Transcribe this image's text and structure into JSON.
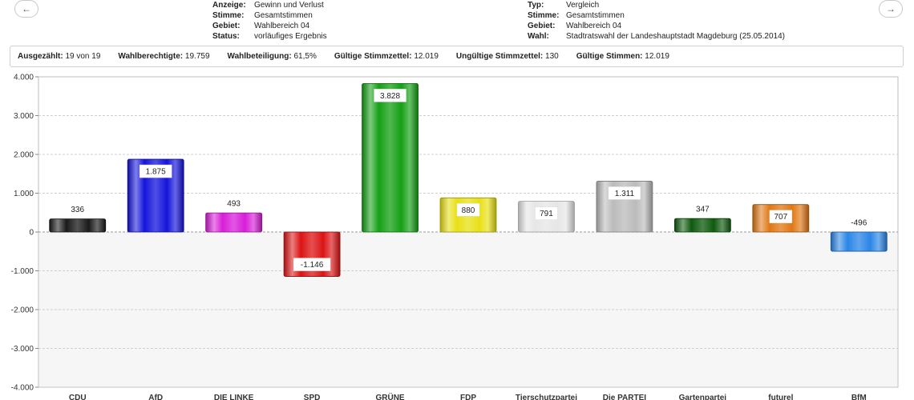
{
  "nav": {
    "prev_icon": "←",
    "next_icon": "→"
  },
  "meta_left": [
    {
      "key": "Anzeige:",
      "value": "Gewinn und Verlust"
    },
    {
      "key": "Stimme:",
      "value": "Gesamtstimmen"
    },
    {
      "key": "Gebiet:",
      "value": "Wahlbereich 04"
    },
    {
      "key": "Status:",
      "value": "vorläufiges Ergebnis"
    }
  ],
  "meta_right": [
    {
      "key": "Typ:",
      "value": "Vergleich"
    },
    {
      "key": "Stimme:",
      "value": "Gesamtstimmen"
    },
    {
      "key": "Gebiet:",
      "value": "Wahlbereich 04"
    },
    {
      "key": "Wahl:",
      "value": "Stadtratswahl der Landeshauptstadt Magdeburg (25.05.2014)"
    }
  ],
  "stats": [
    {
      "label": "Ausgezählt:",
      "value": "19 von 19"
    },
    {
      "label": "Wahlberechtigte:",
      "value": "19.759"
    },
    {
      "label": "Wahlbeteiligung:",
      "value": "61,5%"
    },
    {
      "label": "Gültige Stimmzettel:",
      "value": "12.019"
    },
    {
      "label": "Ungültige Stimmzettel:",
      "value": "130"
    },
    {
      "label": "Gültige Stimmen:",
      "value": "12.019"
    }
  ],
  "chart_data": {
    "type": "bar",
    "categories": [
      "CDU",
      "AfD",
      "DIE LINKE",
      "SPD",
      "GRÜNE",
      "FDP",
      "Tierschutzpartei",
      "Die PARTEI",
      "Gartenpartei",
      "futurel",
      "BfM"
    ],
    "values": [
      336,
      1875,
      493,
      -1146,
      3828,
      880,
      791,
      1311,
      347,
      707,
      -496
    ],
    "value_labels": [
      "336",
      "1.875",
      "493",
      "-1.146",
      "3.828",
      "880",
      "791",
      "1.311",
      "347",
      "707",
      "-496"
    ],
    "colors": [
      "#1a1a1a",
      "#1414dc",
      "#d81ed8",
      "#dc1414",
      "#14a014",
      "#e8e014",
      "#e6e6e6",
      "#bbbbbb",
      "#0e5a0e",
      "#e07814",
      "#2a86e6"
    ],
    "ylim": [
      -4000,
      4000
    ],
    "yticks": [
      4000,
      3000,
      2000,
      1000,
      0,
      -1000,
      -2000,
      -3000,
      -4000
    ],
    "ytick_labels": [
      "4.000",
      "3.000",
      "2.000",
      "1.000",
      "0",
      "-1.000",
      "-2.000",
      "-3.000",
      "-4.000"
    ],
    "grid": true,
    "xlabel": "",
    "ylabel": ""
  }
}
